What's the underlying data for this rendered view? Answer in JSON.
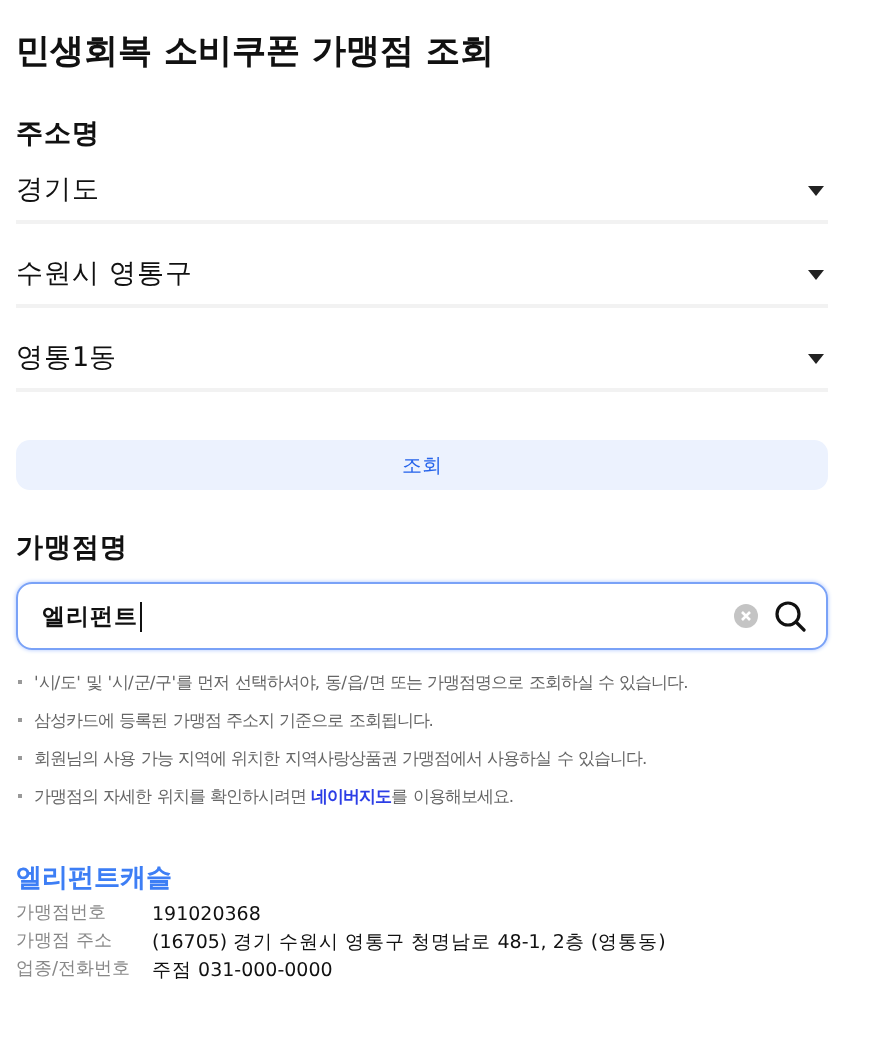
{
  "title": "민생회복 소비쿠폰 가맹점 조회",
  "address_section": {
    "label": "주소명",
    "selects": [
      {
        "value": "경기도"
      },
      {
        "value": "수원시 영통구"
      },
      {
        "value": "영통1동"
      }
    ]
  },
  "search_button": {
    "label": "조회"
  },
  "store_section": {
    "label": "가맹점명",
    "search_field": {
      "value": "엘리펀트"
    }
  },
  "notes": [
    {
      "text": "'시/도' 및 '시/군/구'를 먼저 선택하셔야, 동/읍/면 또는 가맹점명으로 조회하실 수 있습니다."
    },
    {
      "text": "삼성카드에 등록된 가맹점 주소지 기준으로 조회됩니다."
    },
    {
      "text": "회원님의 사용 가능 지역에 위치한 지역사랑상품권 가맹점에서 사용하실 수 있습니다."
    },
    {
      "text": "가맹점의 자세한 위치를 확인하시려면 ",
      "link": "네이버지도",
      "after": "를 이용해보세요."
    }
  ],
  "result": {
    "name": "엘리펀트캐슬",
    "rows": [
      {
        "label": "가맹점번호",
        "value": "191020368"
      },
      {
        "label": "가맹점 주소",
        "value": "(16705) 경기 수원시 영통구 청명남로 48-1, 2층 (영통동)"
      },
      {
        "label": "업종/전화번호",
        "value": "주점 031-000-0000"
      }
    ]
  }
}
